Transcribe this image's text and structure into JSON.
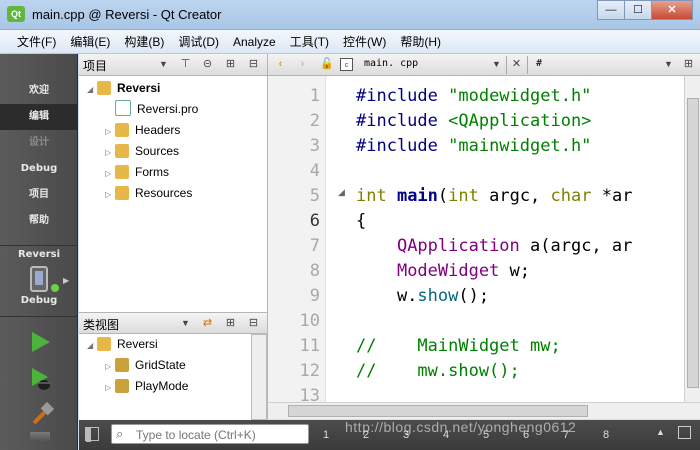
{
  "window": {
    "title": "main.cpp @ Reversi - Qt Creator",
    "app_icon_text": "Qt",
    "controls": {
      "minimize": "—",
      "maximize": "☐",
      "close": "✕"
    }
  },
  "menu": [
    "文件(F)",
    "编辑(E)",
    "构建(B)",
    "调试(D)",
    "Analyze",
    "工具(T)",
    "控件(W)",
    "帮助(H)"
  ],
  "modes": [
    {
      "label": "欢迎",
      "state": "normal"
    },
    {
      "label": "编辑",
      "state": "active"
    },
    {
      "label": "设计",
      "state": "disabled"
    },
    {
      "label": "Debug",
      "state": "normal"
    },
    {
      "label": "项目",
      "state": "normal"
    },
    {
      "label": "帮助",
      "state": "normal"
    }
  ],
  "target": {
    "project": "Reversi",
    "config": "Debug"
  },
  "project_panel": {
    "title": "项目",
    "tree": [
      {
        "label": "Reversi",
        "icon": "project-folder-icon",
        "expanded": true,
        "level": 0,
        "bold": true
      },
      {
        "label": "Reversi.pro",
        "icon": "pro-file-icon",
        "level": 1
      },
      {
        "label": "Headers",
        "icon": "headers-folder-icon",
        "level": 1,
        "collapsed": true
      },
      {
        "label": "Sources",
        "icon": "sources-folder-icon",
        "level": 1,
        "collapsed": true
      },
      {
        "label": "Forms",
        "icon": "forms-folder-icon",
        "level": 1,
        "collapsed": true
      },
      {
        "label": "Resources",
        "icon": "resources-folder-icon",
        "level": 1,
        "collapsed": true
      }
    ]
  },
  "class_panel": {
    "title": "类视图",
    "tree": [
      {
        "label": "Reversi",
        "icon": "folder-icon",
        "level": 0
      },
      {
        "label": "GridState",
        "icon": "class-icon",
        "level": 1
      },
      {
        "label": "PlayMode",
        "icon": "class-icon",
        "level": 1
      }
    ]
  },
  "editor": {
    "filename": "main. cpp",
    "symbol": "#",
    "current_line": 6,
    "lines": [
      {
        "n": "1",
        "html": [
          [
            "pp",
            "#include "
          ],
          [
            "str",
            "\"modewidget.h\""
          ]
        ]
      },
      {
        "n": "2",
        "html": [
          [
            "pp",
            "#include "
          ],
          [
            "str",
            "<QApplication>"
          ]
        ]
      },
      {
        "n": "3",
        "html": [
          [
            "pp",
            "#include "
          ],
          [
            "str",
            "\"mainwidget.h\""
          ]
        ]
      },
      {
        "n": "4",
        "html": []
      },
      {
        "n": "5",
        "html": [
          [
            "kw",
            "int "
          ],
          [
            "bold",
            "main"
          ],
          [
            "",
            "("
          ],
          [
            "kw",
            "int "
          ],
          [
            "",
            "argc, "
          ],
          [
            "kw",
            "char "
          ],
          [
            "",
            "*ar"
          ]
        ]
      },
      {
        "n": "6",
        "html": [
          [
            "",
            "{"
          ]
        ]
      },
      {
        "n": "7",
        "html": [
          [
            "",
            "    "
          ],
          [
            "type",
            "QApplication "
          ],
          [
            "",
            "a(argc, ar"
          ]
        ]
      },
      {
        "n": "8",
        "html": [
          [
            "",
            "    "
          ],
          [
            "type",
            "ModeWidget "
          ],
          [
            "",
            "w;"
          ]
        ]
      },
      {
        "n": "9",
        "html": [
          [
            "",
            "    w."
          ],
          [
            "fn",
            "show"
          ],
          [
            "",
            "();"
          ]
        ]
      },
      {
        "n": "10",
        "html": []
      },
      {
        "n": "11",
        "html": [
          [
            "cm",
            "//    MainWidget mw;"
          ]
        ]
      },
      {
        "n": "12",
        "html": [
          [
            "cm",
            "//    mw.show();"
          ]
        ]
      },
      {
        "n": "13",
        "html": []
      }
    ]
  },
  "status": {
    "locator_placeholder": "Type to locate (Ctrl+K)",
    "output_tabs": [
      "1",
      "2",
      "3",
      "4",
      "5",
      "6",
      "7",
      "8"
    ],
    "watermark": "http://blog.csdn.net/yongheng0612"
  },
  "colors": {
    "accent_green": "#5fb83c",
    "sidebar": "#4f4f4f",
    "titlebar": "#b3cdea"
  }
}
